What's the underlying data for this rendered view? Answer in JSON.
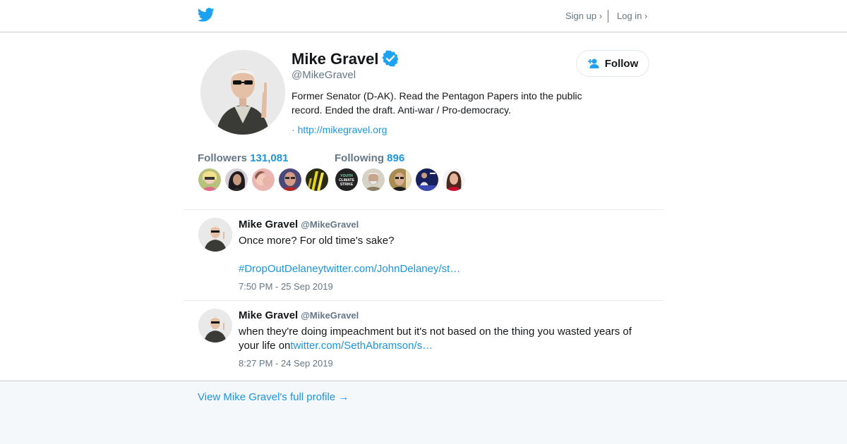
{
  "nav": {
    "signup": "Sign up ›",
    "login": "Log in ›"
  },
  "profile": {
    "name": "Mike Gravel",
    "handle": "@MikeGravel",
    "bio": "Former Senator (D-AK). Read the Pentagon Papers into the public record. Ended the draft. Anti-war / Pro-democracy.",
    "url_prefix": "·",
    "url": "http://mikegravel.org",
    "follow_label": "Follow"
  },
  "followers": {
    "label": "Followers",
    "count": "131,081",
    "avatars": [
      "#c9b37a",
      "#2b2530",
      "#d9a9a0",
      "#8a4a4a",
      "#e0c230"
    ]
  },
  "following": {
    "label": "Following",
    "count": "896",
    "youth_climate_strike_text": "YOUTH CLIMATE STRIKE",
    "avatars": [
      "#222222",
      "#b3a890",
      "#6b5a3a",
      "#2a2a6a",
      "#b21e2a"
    ]
  },
  "tweets": [
    {
      "name": "Mike Gravel",
      "handle": "@MikeGravel",
      "text": "Once more? For old time's sake?",
      "hashtag": "#DropOutDelaney",
      "link": "twitter.com/JohnDelaney/st…",
      "time": "7:50 PM - 25 Sep 2019"
    },
    {
      "name": "Mike Gravel",
      "handle": "@MikeGravel",
      "text": "when they're doing impeachment but it's not based on the thing you wasted years of your life on",
      "link": "twitter.com/SethAbramson/s…",
      "time": "8:27 PM - 24 Sep 2019"
    }
  ],
  "footer": {
    "link": "View Mike Gravel's full profile →"
  },
  "colors": {
    "accent": "#1b95e0",
    "verified": "#1da1f2",
    "twitter_blue": "#1da1f2",
    "muted": "#657786"
  }
}
